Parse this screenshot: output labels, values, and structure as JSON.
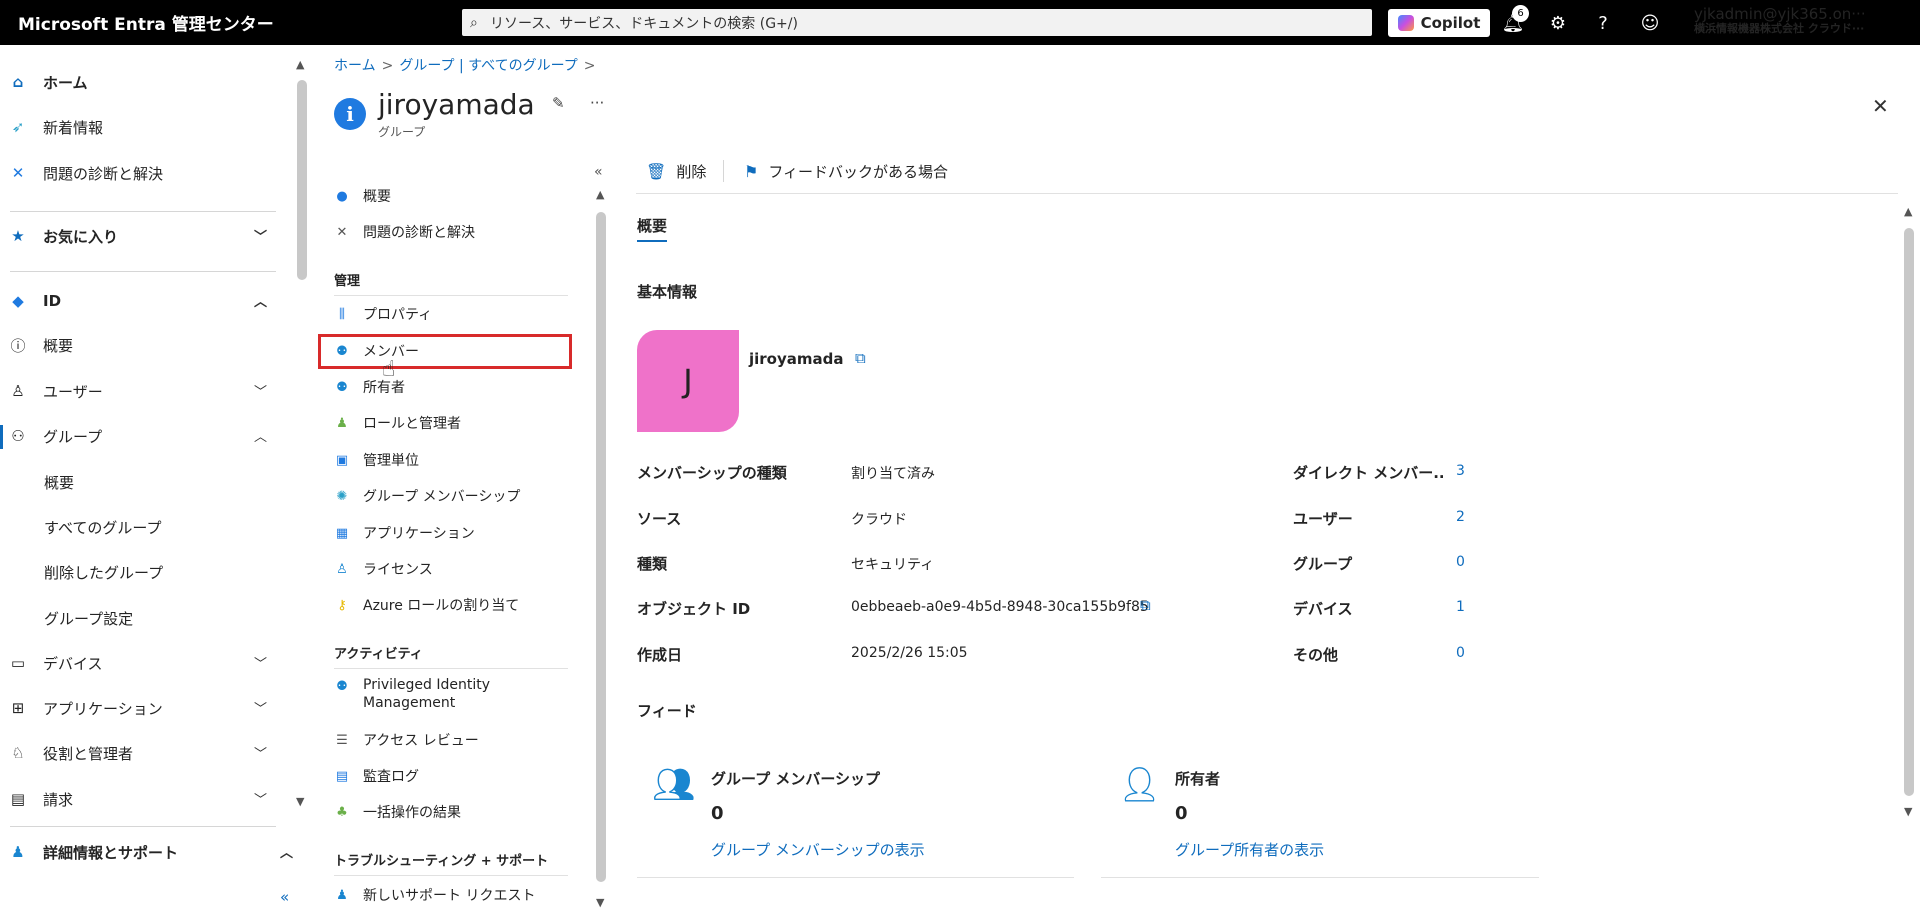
{
  "topbar": {
    "brand": "Microsoft Entra 管理センター",
    "search_placeholder": "リソース、サービス、ドキュメントの検索 (G+/)",
    "copilot_label": "Copilot",
    "notification_count": "6",
    "user_email": "yjkadmin@yjk365.on···",
    "user_org": "横浜情報機器株式会社 クラウド···"
  },
  "nav": {
    "home": "ホーム",
    "whats_new": "新着情報",
    "diagnose": "問題の診断と解決",
    "favorites": "お気に入り",
    "id": "ID",
    "overview": "概要",
    "users": "ユーザー",
    "groups": "グループ",
    "groups_overview": "概要",
    "all_groups": "すべてのグループ",
    "deleted_groups": "削除したグループ",
    "group_settings": "グループ設定",
    "devices": "デバイス",
    "applications": "アプリケーション",
    "roles_admins": "役割と管理者",
    "billing": "請求",
    "learn_support": "詳細情報とサポート",
    "collapse": "«"
  },
  "breadcrumb": {
    "home": "ホーム",
    "groups": "グループ | すべてのグループ"
  },
  "header": {
    "title": "jiroyamada",
    "subtitle": "グループ"
  },
  "resource_menu": {
    "overview": "概要",
    "diagnose": "問題の診断と解決",
    "section_manage": "管理",
    "properties": "プロパティ",
    "members": "メンバー",
    "owners": "所有者",
    "roles_admins": "ロールと管理者",
    "admin_units": "管理単位",
    "group_memberships": "グループ メンバーシップ",
    "applications": "アプリケーション",
    "licenses": "ライセンス",
    "azure_roles": "Azure ロールの割り当て",
    "section_activity": "アクティビティ",
    "pim_line1": "Privileged Identity",
    "pim_line2": "Management",
    "access_reviews": "アクセス レビュー",
    "audit_logs": "監査ログ",
    "bulk_results": "一括操作の結果",
    "section_troubleshoot": "トラブルシューティング + サポート",
    "new_support": "新しいサポート リクエスト"
  },
  "command_bar": {
    "delete": "削除",
    "feedback": "フィードバックがある場合"
  },
  "content": {
    "tab_overview": "概要",
    "basic_info": "基本情報",
    "avatar_letter": "J",
    "group_name": "jiroyamada",
    "props": [
      {
        "label": "メンバーシップの種類",
        "value": "割り当て済み"
      },
      {
        "label": "ソース",
        "value": "クラウド"
      },
      {
        "label": "種類",
        "value": "セキュリティ"
      },
      {
        "label": "オブジェクト ID",
        "value": "0ebbeaeb-a0e9-4b5d-8948-30ca155b9f85"
      },
      {
        "label": "作成日",
        "value": "2025/2/26 15:05"
      }
    ],
    "counts": [
      {
        "label": "ダイレクト メンバー...",
        "value": "3"
      },
      {
        "label": "ユーザー",
        "value": "2"
      },
      {
        "label": "グループ",
        "value": "0"
      },
      {
        "label": "デバイス",
        "value": "1"
      },
      {
        "label": "その他",
        "value": "0"
      }
    ],
    "feed": "フィード",
    "cards": [
      {
        "title": "グループ メンバーシップ",
        "count": "0",
        "link": "グループ メンバーシップの表示"
      },
      {
        "title": "所有者",
        "count": "0",
        "link": "グループ所有者の表示"
      }
    ]
  }
}
